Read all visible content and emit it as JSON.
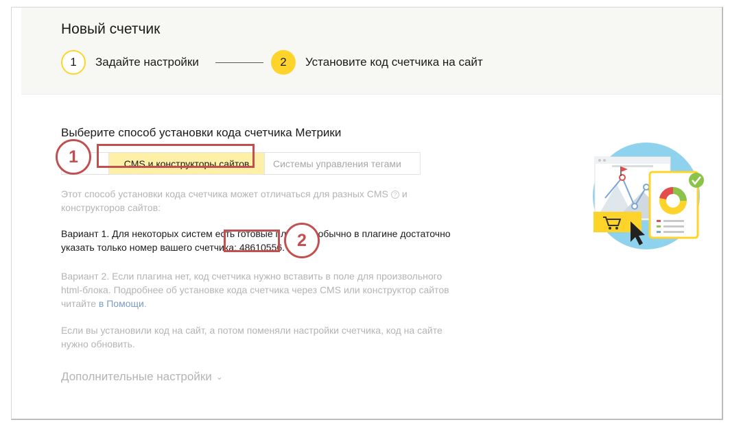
{
  "header": {
    "title": "Новый счетчик",
    "steps": [
      {
        "num": "1",
        "label": "Задайте настройки"
      },
      {
        "num": "2",
        "label": "Установите код счетчика на сайт"
      }
    ]
  },
  "section": {
    "title": "Выберите способ установки кода счетчика Метрики",
    "tabs": [
      "",
      "CMS и конструкторы сайтов",
      "Системы управления тегами"
    ],
    "note_part1": "Этот способ установки кода счетчика может отличаться для разных CMS",
    "note_part2": "и конструкторов сайтов:",
    "help_icon": "?",
    "variant1_text": "Вариант 1. Для некоторых систем есть готовые плагины, обычно в плагине достаточно указать только номер вашего счетчика:",
    "counter_number": "48610556",
    "counter_suffix": ".",
    "variant2_text": "Вариант 2. Если плагина нет, код счетчика нужно вставить в поле для произвольного html-блока. Подробнее об установке кода счетчика через CMS или конструктор сайтов читайте",
    "variant2_link": "в Помощи",
    "variant2_suffix": ".",
    "reinstall_text": "Если вы установили код на сайт, а потом поменяли настройки счетчика, код на сайте нужно обновить.",
    "more_settings": "Дополнительные настройки",
    "chevron": "⌄"
  },
  "annotations": {
    "badge1": "1",
    "badge2": "2",
    "color": "#c24f4f"
  },
  "colors": {
    "accent_yellow": "#ffd42a",
    "active_tab": "#fff0a8",
    "link": "#7a9cc6"
  }
}
